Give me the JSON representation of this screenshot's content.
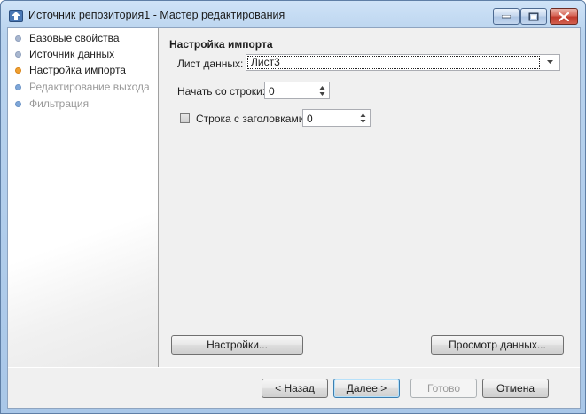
{
  "window": {
    "title": "Источник репозитория1 - Мастер редактирования"
  },
  "nav": {
    "items": [
      {
        "label": "Базовые свойства",
        "state": "done"
      },
      {
        "label": "Источник данных",
        "state": "done"
      },
      {
        "label": "Настройка импорта",
        "state": "current"
      },
      {
        "label": "Редактирование выхода",
        "state": "pending"
      },
      {
        "label": "Фильтрация",
        "state": "pending"
      }
    ]
  },
  "content": {
    "section_title": "Настройка импорта",
    "sheet_label": "Лист данных:",
    "sheet_value": "Лист3",
    "start_row_label": "Начать со строки:",
    "start_row_value": "0",
    "header_row_checked": false,
    "header_row_label": "Строка с заголовками:",
    "header_row_value": "0",
    "settings_button": "Настройки...",
    "preview_button": "Просмотр данных..."
  },
  "footer": {
    "back_button": "< Назад",
    "next_button": "Далее >",
    "finish_button": "Готово",
    "cancel_button": "Отмена"
  },
  "colors": {
    "current_step": "#f0a030",
    "pending_step": "#7fa7d8",
    "done_step": "#a9b7cf"
  }
}
